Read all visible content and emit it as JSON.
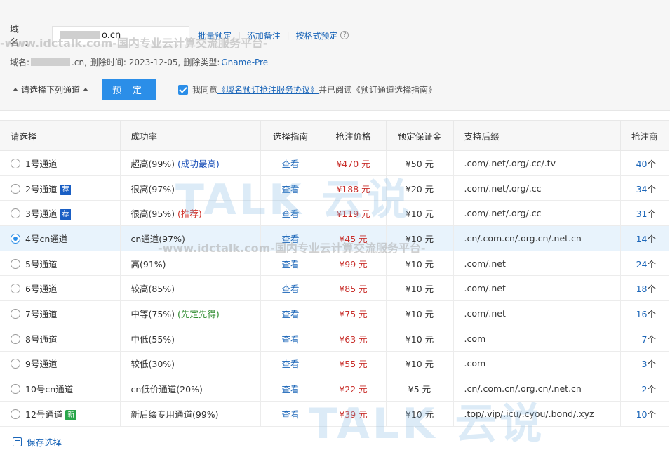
{
  "form": {
    "domain_label": "域 名:",
    "domain_value_visible": "o.cn",
    "links": [
      "批量预定",
      "添加备注",
      "按格式预定"
    ],
    "help_icon": "question-icon",
    "info_prefix": "域名:",
    "info_domain_suffix": ".cn,",
    "info_deleted": "删除时间: 2023-12-05,",
    "info_type_label": "删除类型:",
    "info_type_value": "Gname-Pre",
    "select_channel": "请选择下列通道",
    "book_button": "预 定",
    "agree_prefix": "我同意",
    "agree_link": "《域名预订抢注服务协议》",
    "agree_suffix": "并已阅读《预订通道选择指南》"
  },
  "table": {
    "headers": [
      "请选择",
      "成功率",
      "选择指南",
      "抢注价格",
      "预定保证金",
      "支持后缀",
      "抢注商"
    ],
    "rows": [
      {
        "name": "1号通道",
        "badge": "",
        "rate": "超高(99%)",
        "note": "(成功最高)",
        "note_color": "blue",
        "guide": "查看",
        "price": "¥470 元",
        "deposit": "¥50 元",
        "suffix": ".com/.net/.org/.cc/.tv",
        "count": "40",
        "unit": "个",
        "selected": false
      },
      {
        "name": "2号通道",
        "badge": "荐",
        "badge_color": "blue",
        "rate": "很高(97%)",
        "note": "",
        "guide": "查看",
        "price": "¥188 元",
        "deposit": "¥20 元",
        "suffix": ".com/.net/.org/.cc",
        "count": "34",
        "unit": "个",
        "selected": false
      },
      {
        "name": "3号通道",
        "badge": "荐",
        "badge_color": "blue",
        "rate": "很高(95%)",
        "note": "(推荐)",
        "note_color": "red",
        "guide": "查看",
        "price": "¥119 元",
        "deposit": "¥10 元",
        "suffix": ".com/.net/.org/.cc",
        "count": "31",
        "unit": "个",
        "selected": false
      },
      {
        "name": "4号cn通道",
        "badge": "",
        "rate": "cn通道(97%)",
        "note": "",
        "guide": "查看",
        "price": "¥45 元",
        "deposit": "¥10 元",
        "suffix": ".cn/.com.cn/.org.cn/.net.cn",
        "count": "14",
        "unit": "个",
        "selected": true
      },
      {
        "name": "5号通道",
        "badge": "",
        "rate": "高(91%)",
        "note": "",
        "guide": "查看",
        "price": "¥99 元",
        "deposit": "¥10 元",
        "suffix": ".com/.net",
        "count": "24",
        "unit": "个",
        "selected": false
      },
      {
        "name": "6号通道",
        "badge": "",
        "rate": "较高(85%)",
        "note": "",
        "guide": "查看",
        "price": "¥85 元",
        "deposit": "¥10 元",
        "suffix": ".com/.net",
        "count": "18",
        "unit": "个",
        "selected": false
      },
      {
        "name": "7号通道",
        "badge": "",
        "rate": "中等(75%)",
        "note": "(先定先得)",
        "note_color": "green",
        "guide": "查看",
        "price": "¥75 元",
        "deposit": "¥10 元",
        "suffix": ".com/.net",
        "count": "16",
        "unit": "个",
        "selected": false
      },
      {
        "name": "8号通道",
        "badge": "",
        "rate": "中低(55%)",
        "note": "",
        "guide": "查看",
        "price": "¥63 元",
        "deposit": "¥10 元",
        "suffix": ".com",
        "count": "7",
        "unit": "个",
        "selected": false
      },
      {
        "name": "9号通道",
        "badge": "",
        "rate": "较低(30%)",
        "note": "",
        "guide": "查看",
        "price": "¥55 元",
        "deposit": "¥10 元",
        "suffix": ".com",
        "count": "3",
        "unit": "个",
        "selected": false
      },
      {
        "name": "10号cn通道",
        "badge": "",
        "rate": "cn低价通道(20%)",
        "note": "",
        "guide": "查看",
        "price": "¥22 元",
        "deposit": "¥5 元",
        "suffix": ".cn/.com.cn/.org.cn/.net.cn",
        "count": "2",
        "unit": "个",
        "selected": false
      },
      {
        "name": "12号通道",
        "badge": "新",
        "badge_color": "green",
        "rate": "新后缀专用通道(99%)",
        "note": "",
        "guide": "查看",
        "price": "¥39 元",
        "deposit": "¥10 元",
        "suffix": ".top/.vip/.icu/.cyou/.bond/.xyz",
        "count": "10",
        "unit": "个",
        "selected": false
      }
    ]
  },
  "save_label": "保存选择",
  "watermark": {
    "logo": "TALK 云说",
    "text": "-www.idctalk.com-国内专业云计算交流服务平台-"
  },
  "colors": {
    "accent": "#2b8ee8",
    "link": "#1a65b8",
    "price": "#c9302c",
    "selected_row": "#e8f3fc"
  }
}
